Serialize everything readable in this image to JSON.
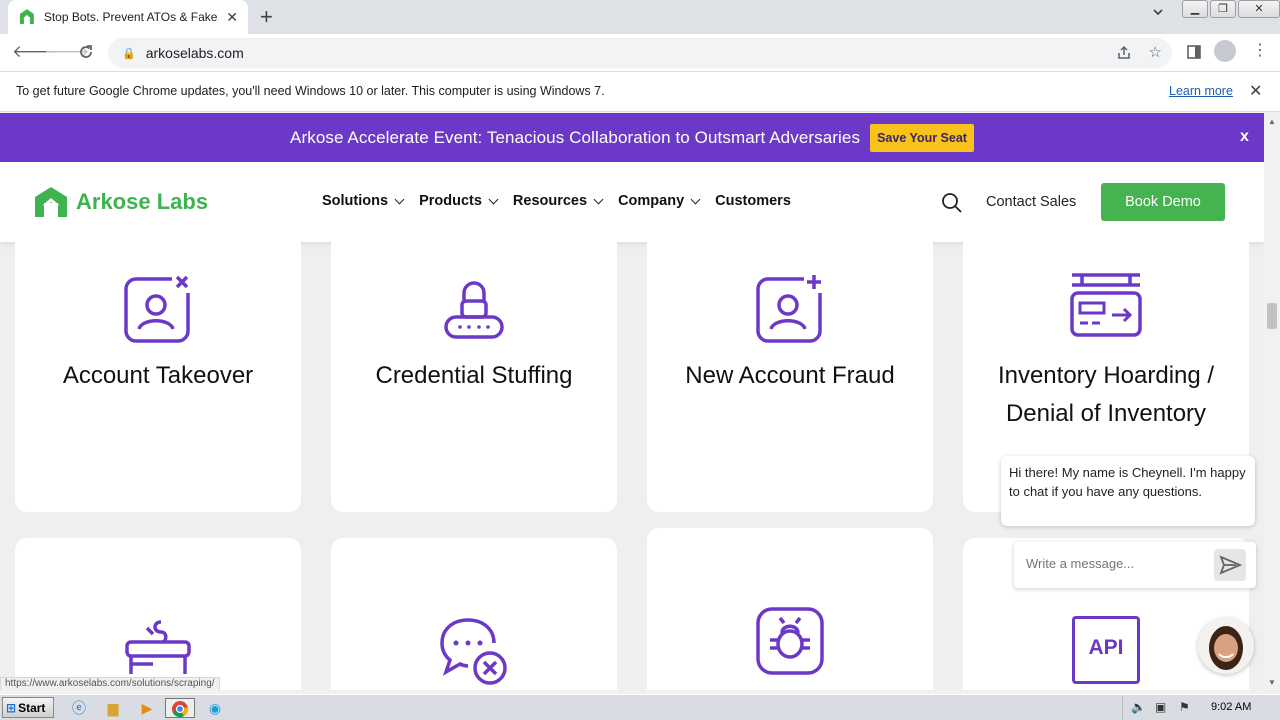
{
  "browser": {
    "tab_title": "Stop Bots. Prevent ATOs & Fake Acc",
    "url": "arkoselabs.com",
    "new_tab_glyph": "+",
    "close_glyph": "✕"
  },
  "infobar": {
    "message": "To get future Google Chrome updates, you'll need Windows 10 or later. This computer is using Windows 7.",
    "link": "Learn more"
  },
  "promo": {
    "text": "Arkose Accelerate Event: Tenacious Collaboration to Outsmart Adversaries",
    "button": "Save Your Seat",
    "close": "x"
  },
  "header": {
    "logo": "Arkose Labs",
    "nav": [
      {
        "label": "Solutions",
        "dropdown": true
      },
      {
        "label": "Products",
        "dropdown": true
      },
      {
        "label": "Resources",
        "dropdown": true
      },
      {
        "label": "Company",
        "dropdown": true
      },
      {
        "label": "Customers",
        "dropdown": false
      }
    ],
    "contact": "Contact Sales",
    "cta": "Book Demo"
  },
  "cards": [
    {
      "title": "Account Takeover",
      "icon": "account-takeover-icon"
    },
    {
      "title": "Credential Stuffing",
      "icon": "credential-stuffing-icon"
    },
    {
      "title": "New Account Fraud",
      "icon": "new-account-fraud-icon"
    },
    {
      "title_line1": "Inventory Hoarding /",
      "title_line2": "Denial of Inventory",
      "icon": "inventory-hoarding-icon"
    },
    {
      "icon": "scraping-icon"
    },
    {
      "icon": "spam-icon"
    },
    {
      "icon": "bug-icon"
    },
    {
      "icon": "api-icon",
      "icon_text": "API"
    }
  ],
  "status_url": "https://www.arkoselabs.com/solutions/scraping/",
  "chat": {
    "message": "Hi there! My name is Cheynell. I'm happy to chat if you have any questions.",
    "placeholder": "Write a message..."
  },
  "taskbar": {
    "start": "Start",
    "time": "9:02 AM"
  },
  "colors": {
    "purple": "#6b38c8",
    "green": "#45b34f",
    "yellow": "#f7c31a"
  }
}
